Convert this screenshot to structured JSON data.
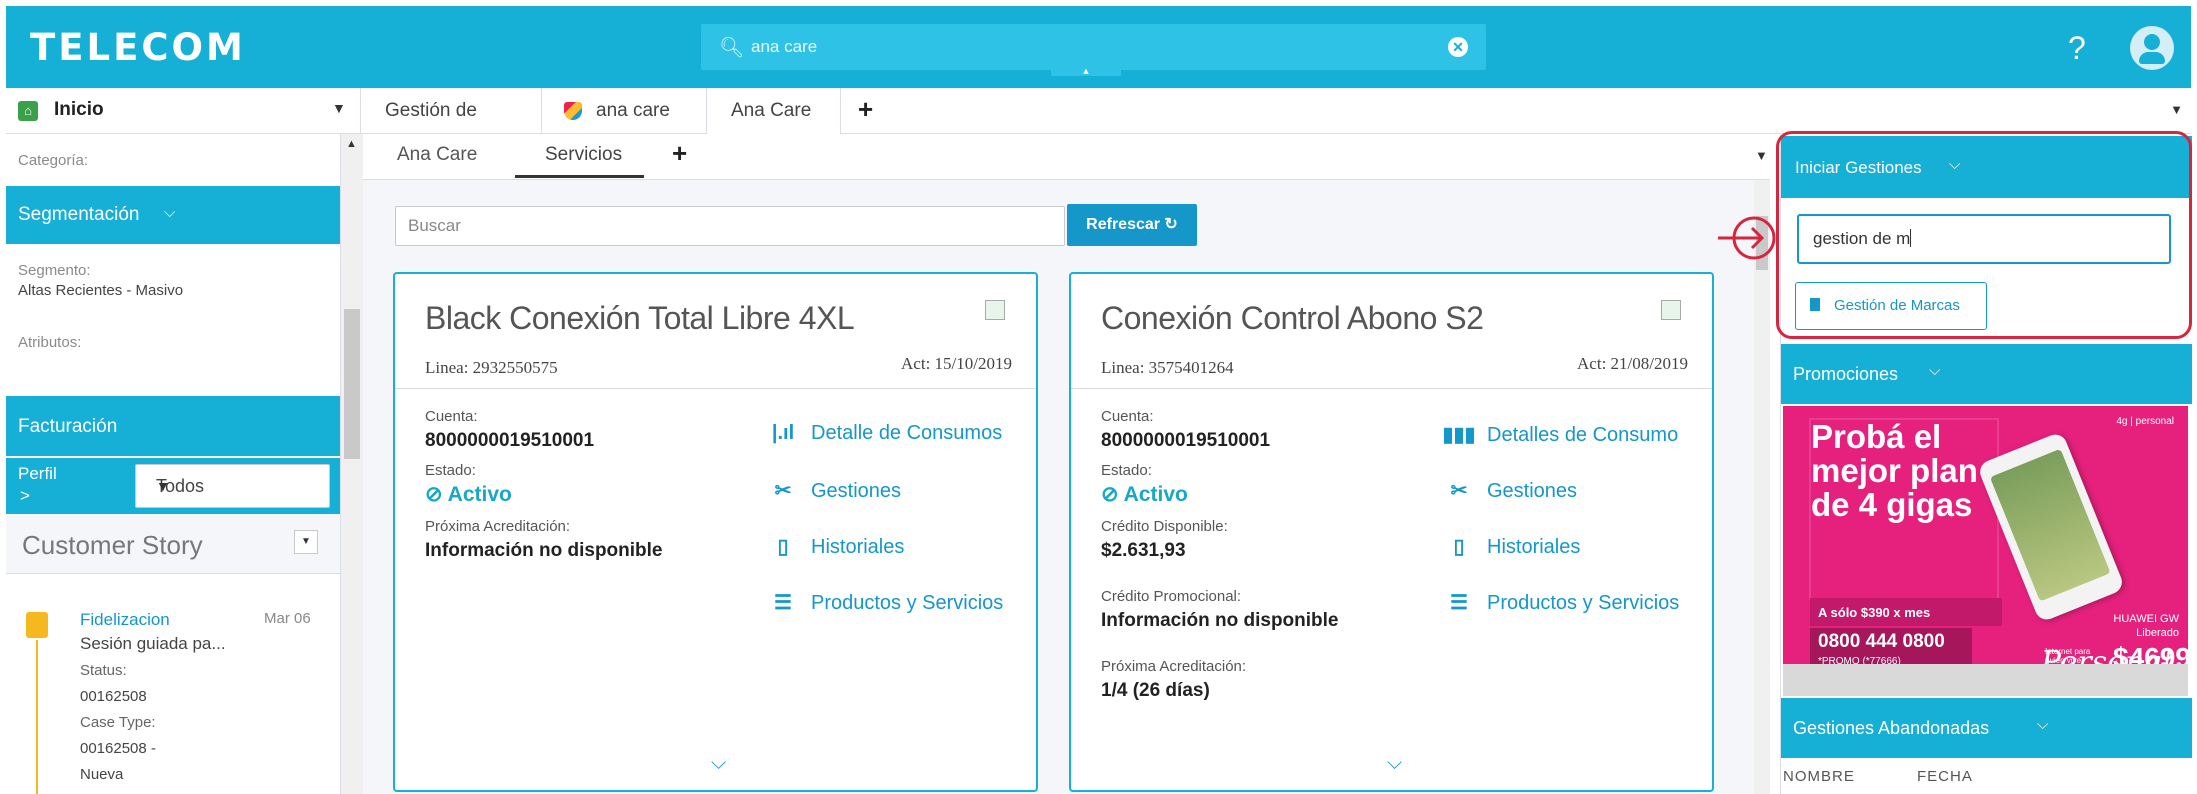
{
  "header": {
    "brand": "TELECOM",
    "search_value": "ana care",
    "help_label": "?"
  },
  "tabs": {
    "home_label": "Inicio",
    "items": [
      {
        "label": "Gestión de clientes"
      },
      {
        "label": "ana care"
      },
      {
        "label": "Ana Care"
      }
    ],
    "add": "+"
  },
  "sidebar": {
    "categoria_label": "Categoría:",
    "segmentacion_title": "Segmentación",
    "segmento_label": "Segmento:",
    "segmento_value": "Altas Recientes - Masivo",
    "atributos_label": "Atributos:",
    "facturacion_title": "Facturación",
    "perfil_label": "Perfil",
    "perfil_arrow": ">",
    "perfil_select": "Todos",
    "customer_story_title": "Customer Story",
    "story": {
      "title": "Fidelizacion",
      "date": "Mar 06",
      "desc": "Sesión guiada pa...",
      "status_label": "Status:",
      "status_value": "00162508",
      "casetype_label": "Case Type:",
      "casetype_value": "00162508 -",
      "extra": "Nueva"
    }
  },
  "subtabs": {
    "items": [
      {
        "label": "Ana Care"
      },
      {
        "label": "Servicios"
      }
    ],
    "add": "+"
  },
  "main": {
    "search_placeholder": "Buscar",
    "refresh_label": "Refrescar ↻",
    "cards": [
      {
        "title": "Black Conexión Total Libre 4XL",
        "linea": "Linea: 2932550575",
        "act": "Act: 15/10/2019",
        "cuenta_label": "Cuenta:",
        "cuenta_value": "8000000019510001",
        "estado_label": "Estado:",
        "estado_value": "Activo",
        "f1_label": "Próxima Acreditación:",
        "f1_value": "Información no disponible",
        "links": [
          "Detalle de Consumos",
          "Gestiones",
          "Historiales",
          "Productos y Servicios"
        ]
      },
      {
        "title": "Conexión Control Abono S2",
        "linea": "Linea: 3575401264",
        "act": "Act: 21/08/2019",
        "cuenta_label": "Cuenta:",
        "cuenta_value": "8000000019510001",
        "estado_label": "Estado:",
        "estado_value": "Activo",
        "f1_label": "Crédito Disponible:",
        "f1_value": "$2.631,93",
        "f2_label": "Crédito Promocional:",
        "f2_value": "Información no disponible",
        "f3_label": "Próxima Acreditación:",
        "f3_value": "1/4 (26 días)",
        "links": [
          "Detalles de Consumo",
          "Gestiones",
          "Historiales",
          "Productos y Servicios"
        ]
      }
    ]
  },
  "right": {
    "iniciar_title": "Iniciar Gestiones",
    "gestion_input": "gestion de m",
    "gestion_button": "Gestión de Marcas",
    "promos_title": "Promociones",
    "promo": {
      "headline": "Probá el mejor plan de 4 gigas",
      "price_note": "A sólo $390 x mes",
      "phone": "0800 444 0800",
      "promo_code": "*PROMO (*77666)",
      "brand_line": "HUAWEI GW Liberado",
      "price": "$4699",
      "logo": "4g | personal",
      "signature": "Personal",
      "small_text": "Internet para quien vive conectado"
    },
    "abandonadas_title": "Gestiones Abandonadas",
    "col_nombre": "NOMBRE",
    "col_fecha": "FECHA"
  },
  "colors": {
    "brand": "#16b0d6",
    "accent": "#1597c9",
    "highlight": "#d6263d",
    "promo": "#e5217d"
  }
}
